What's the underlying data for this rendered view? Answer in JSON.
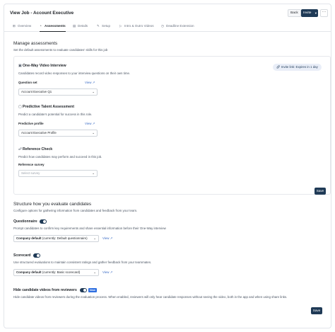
{
  "header": {
    "title": "View Job - Account Executive",
    "back_label": "Back",
    "invite_label": "Invite",
    "more_icon": "ellipsis-icon"
  },
  "tabs": [
    {
      "label": "Overview",
      "icon": "overview-icon"
    },
    {
      "label": "Assessments",
      "icon": "gauge-icon",
      "active": true
    },
    {
      "label": "Details",
      "icon": "document-icon"
    },
    {
      "label": "Setup",
      "icon": "wrench-icon"
    },
    {
      "label": "Intro & Outro Videos",
      "icon": "play-icon"
    },
    {
      "label": "Deadline Extension",
      "icon": "clock-icon"
    }
  ],
  "manage": {
    "title": "Manage assessments",
    "subtitle": "Set the default assessments to evaluate candidates' skills for this job",
    "video": {
      "title": "One-Way Video Interview",
      "desc": "Candidates record video responses to your interview questions on their own time.",
      "invite_link": "Invite link: Expires in 1 day",
      "field_label": "Question set",
      "view_label": "View",
      "value": "Account Executive Q1"
    },
    "predictive": {
      "title": "Predictive Talent Assessment",
      "desc": "Predict a candidate's potential for success in this role.",
      "field_label": "Predictive profile",
      "view_label": "View",
      "value": "Account Executive Profile"
    },
    "reference": {
      "title": "Reference Check",
      "desc": "Predict how candidates may perform and succeed in this job.",
      "field_label": "Reference survey",
      "placeholder": "Select survey"
    },
    "save_label": "Save"
  },
  "structure": {
    "title": "Structure how you evaluate candidates",
    "subtitle": "Configure options for gathering information from candidates and feedback from your team.",
    "questionnaire": {
      "label": "Questionnaire",
      "enabled": true,
      "desc": "Prompt candidates to confirm key requirements and share essential information before their One-Way interview",
      "select_bold": "Company default",
      "select_rest": "(currently: Default questionnaire)",
      "view_label": "View"
    },
    "scorecard": {
      "label": "Scorecard",
      "enabled": true,
      "desc": "Use structured evaluations to maintain consistent ratings and gather feedback from your teammates.",
      "select_bold": "Company default",
      "select_rest": "(currently: Basic scorecard)",
      "view_label": "View"
    },
    "hide_videos": {
      "label": "Hide candidate videos from reviewers",
      "enabled": true,
      "badge": "New",
      "desc": "Hide candidate videos from reviewers during the evaluation process. When enabled, reviewers will only hear candidate responses without seeing the video, both in the app and when using share links."
    },
    "save_label": "Save"
  },
  "colors": {
    "primary": "#1f3a56",
    "link": "#3b6cc5",
    "badge": "#2f6fe0"
  }
}
